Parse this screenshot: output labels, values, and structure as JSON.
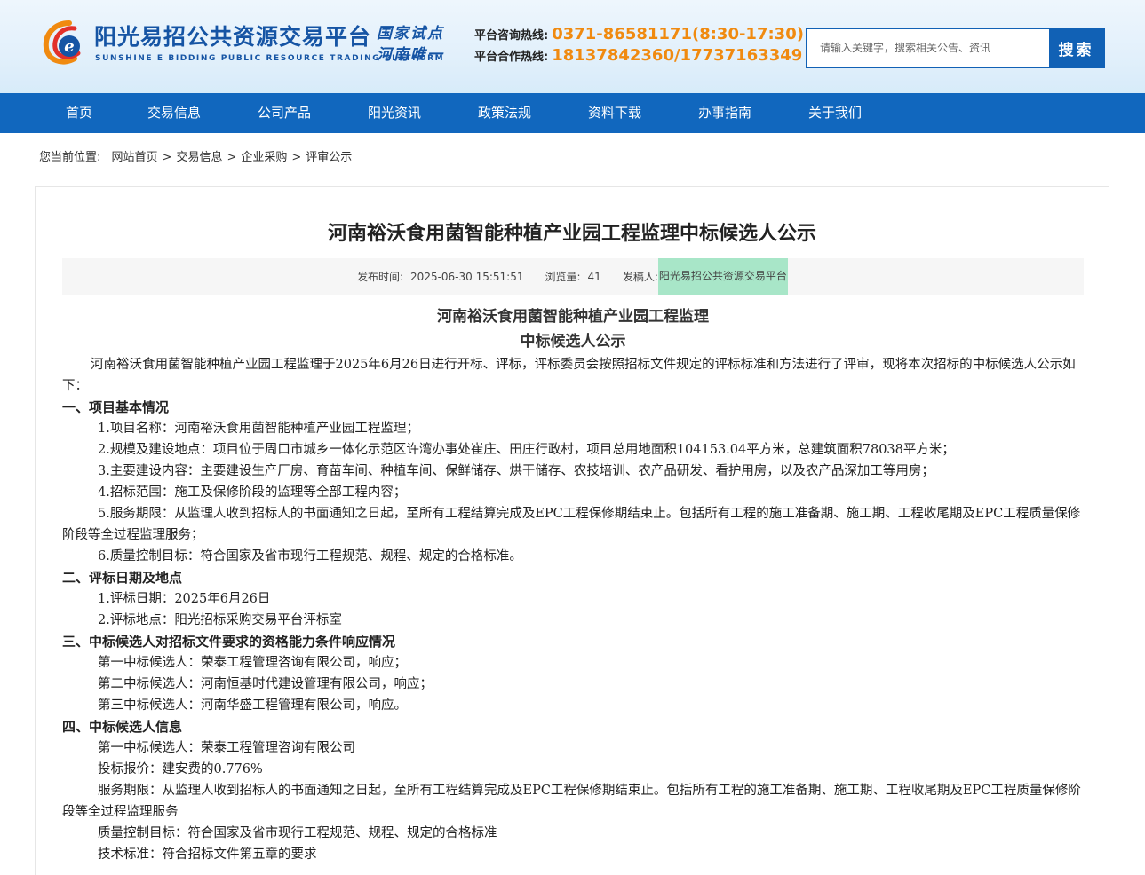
{
  "header": {
    "logo_title": "阳光易招公共资源交易平台",
    "logo_subtitle": "SUNSHINE E BIDDING PUBLIC RESOURCE TRADING PLATFORM",
    "slogan_line1": "国家试点",
    "slogan_line2": "河南唯一",
    "hotline1_label": "平台咨询热线:",
    "hotline1_number": "0371-86581171(8:30-17:30)",
    "hotline2_label": "平台合作热线:",
    "hotline2_number": "18137842360/17737163349",
    "search_placeholder": "请输入关键字，搜索相关公告、资讯",
    "search_button": "搜索",
    "brand_color": "#1161b5",
    "accent_color": "#f08a10"
  },
  "nav": [
    {
      "label": "首页"
    },
    {
      "label": "交易信息"
    },
    {
      "label": "公司产品"
    },
    {
      "label": "阳光资讯"
    },
    {
      "label": "政策法规"
    },
    {
      "label": "资料下载"
    },
    {
      "label": "办事指南"
    },
    {
      "label": "关于我们"
    }
  ],
  "breadcrumb": {
    "prefix": "您当前位置:",
    "items": [
      "网站首页",
      "交易信息",
      "企业采购",
      "评审公示"
    ]
  },
  "article": {
    "title": "河南裕沃食用菌智能种植产业园工程监理中标候选人公示",
    "meta": {
      "date_label": "发布时间:",
      "date": "2025-06-30 15:51:51",
      "views_label": "浏览量:",
      "views": "41",
      "publisher_label": "发稿人:",
      "publisher": "阳光易招公共资源交易平台"
    },
    "doc_heading1": "河南裕沃食用菌智能种植产业园工程监理",
    "doc_heading2": "中标候选人公示",
    "intro": "河南裕沃食用菌智能种植产业园工程监理于2025年6月26日进行开标、评标，评标委员会按照招标文件规定的评标标准和方法进行了评审，现将本次招标的中标候选人公示如下：",
    "sec1": "一、项目基本情况",
    "s1_1": "1.项目名称：河南裕沃食用菌智能种植产业园工程监理；",
    "s1_2": "2.规模及建设地点：项目位于周口市城乡一体化示范区许湾办事处崔庄、田庄行政村，项目总用地面积104153.04平方米，总建筑面积78038平方米；",
    "s1_3": "3.主要建设内容：主要建设生产厂房、育苗车间、种植车间、保鲜储存、烘干储存、农技培训、农产品研发、看护用房，以及农产品深加工等用房；",
    "s1_4": "4.招标范围：施工及保修阶段的监理等全部工程内容；",
    "s1_5": "5.服务期限：从监理人收到招标人的书面通知之日起，至所有工程结算完成及EPC工程保修期结束止。包括所有工程的施工准备期、施工期、工程收尾期及EPC工程质量保修阶段等全过程监理服务；",
    "s1_6": "6.质量控制目标：符合国家及省市现行工程规范、规程、规定的合格标准。",
    "sec2": "二、评标日期及地点",
    "s2_1": "1.评标日期：2025年6月26日",
    "s2_2": "2.评标地点：阳光招标采购交易平台评标室",
    "sec3": "三、中标候选人对招标文件要求的资格能力条件响应情况",
    "s3_1": "第一中标候选人：荣泰工程管理咨询有限公司，响应；",
    "s3_2": "第二中标候选人：河南恒基时代建设管理有限公司，响应；",
    "s3_3": "第三中标候选人：河南华盛工程管理有限公司，响应。",
    "sec4": "四、中标候选人信息",
    "s4_1": "第一中标候选人：荣泰工程管理咨询有限公司",
    "s4_2": "投标报价：建安费的0.776%",
    "s4_3": "服务期限：从监理人收到招标人的书面通知之日起，至所有工程结算完成及EPC工程保修期结束止。包括所有工程的施工准备期、施工期、工程收尾期及EPC工程质量保修阶段等全过程监理服务",
    "s4_4": "质量控制目标：符合国家及省市现行工程规范、规程、规定的合格标准",
    "s4_5": "技术标准：符合招标文件第五章的要求"
  }
}
